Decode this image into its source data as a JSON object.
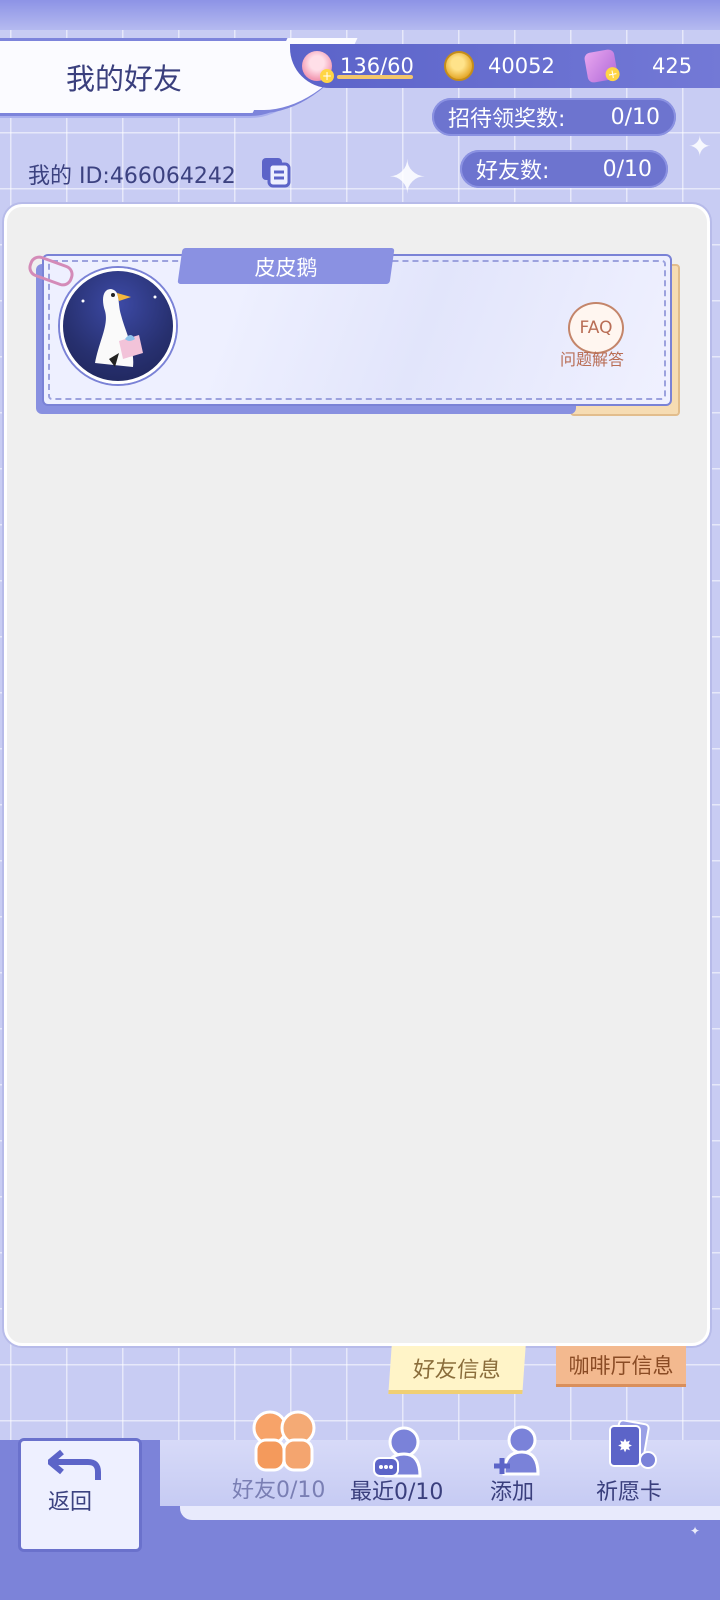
{
  "header": {
    "title": "我的好友"
  },
  "resources": {
    "stamina": "136/60",
    "coins": "40052",
    "gems": "425"
  },
  "stats": {
    "reception_rewards_label": "招待领奖数:",
    "reception_rewards_value": "0/10",
    "friends_count_label": "好友数:",
    "friends_count_value": "0/10"
  },
  "my_id": "我的 ID:466064242",
  "friend_card": {
    "name": "皮皮鹅",
    "faq_badge": "FAQ",
    "faq_label": "问题解答"
  },
  "side_tabs": {
    "friend_info": "好友信息",
    "cafe_info": "咖啡厅信息"
  },
  "bottom_nav": {
    "back": "返回",
    "friends": "好友0/10",
    "recent": "最近0/10",
    "add": "添加",
    "wish_card": "祈愿卡"
  },
  "colors": {
    "accent": "#6d74cf",
    "panel": "#efefef",
    "tab_yellow": "#fff4c8",
    "tab_orange": "#f3b98f"
  }
}
